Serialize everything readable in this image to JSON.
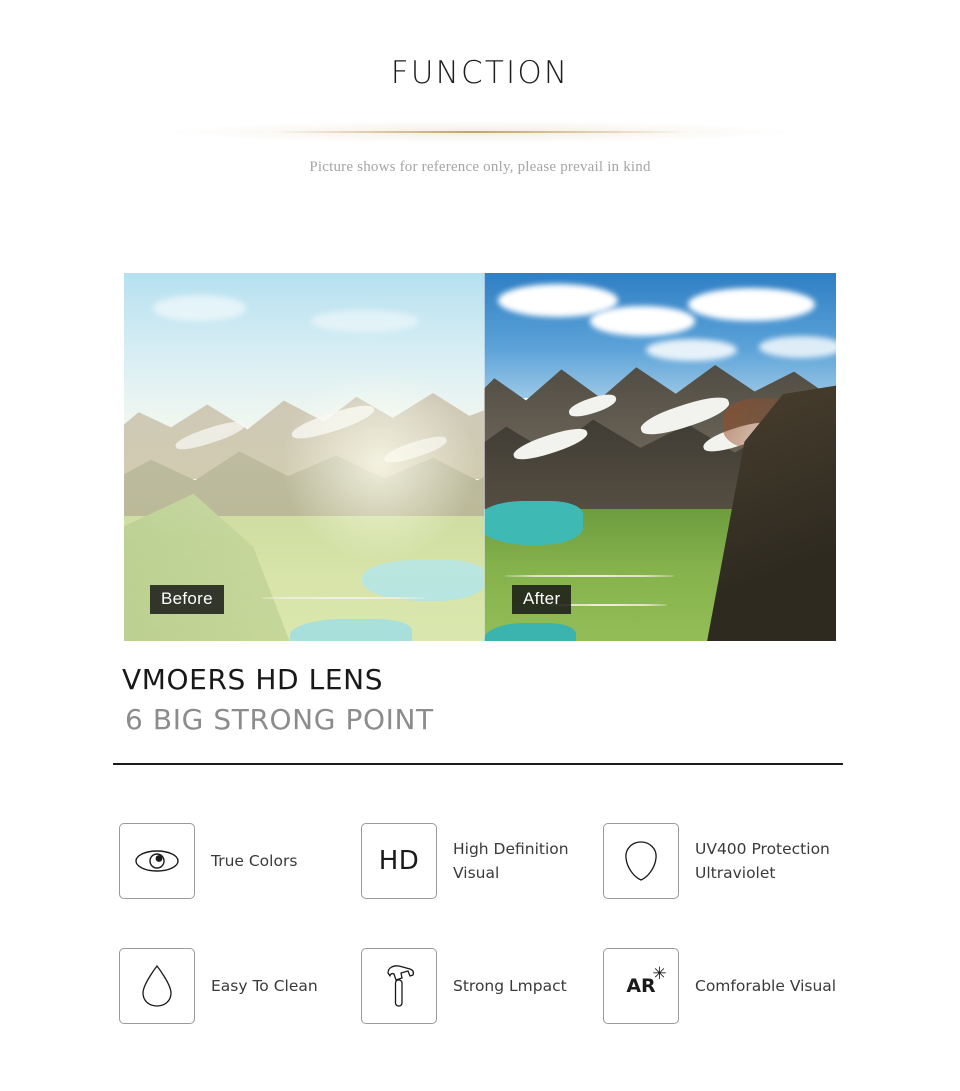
{
  "header": {
    "title": "FUNCTION",
    "subtitle": "Picture shows for reference only, please prevail in kind",
    "divider_color": "#ba9656"
  },
  "comparison": {
    "before_label": "Before",
    "after_label": "After",
    "scene": "alpine mountain valley with turquoise lake and green meadow",
    "before_description": "washed out hazy low-contrast view",
    "after_description": "vivid saturated high-contrast view"
  },
  "headings": {
    "brand": "VMOERS HD LENS",
    "tagline": "6 BIG STRONG POINT",
    "brand_color": "#181818",
    "tagline_color": "#8c8c8c"
  },
  "features": [
    [
      {
        "icon": "eye-icon",
        "icon_glyph": "",
        "label": "True Colors"
      },
      {
        "icon": "hd-text-icon",
        "icon_glyph": "HD",
        "label": "High Definition\nVisual"
      },
      {
        "icon": "uv-shield-icon",
        "icon_glyph": "",
        "label": "UV400 Protection\nUltraviolet"
      }
    ],
    [
      {
        "icon": "water-drop-icon",
        "icon_glyph": "",
        "label": "Easy To Clean"
      },
      {
        "icon": "hammer-icon",
        "icon_glyph": "",
        "label": "Strong Lmpact"
      },
      {
        "icon": "ar-coating-icon",
        "icon_glyph": "AR",
        "icon_spark": "✳",
        "label": "Comforable Visual"
      }
    ]
  ]
}
